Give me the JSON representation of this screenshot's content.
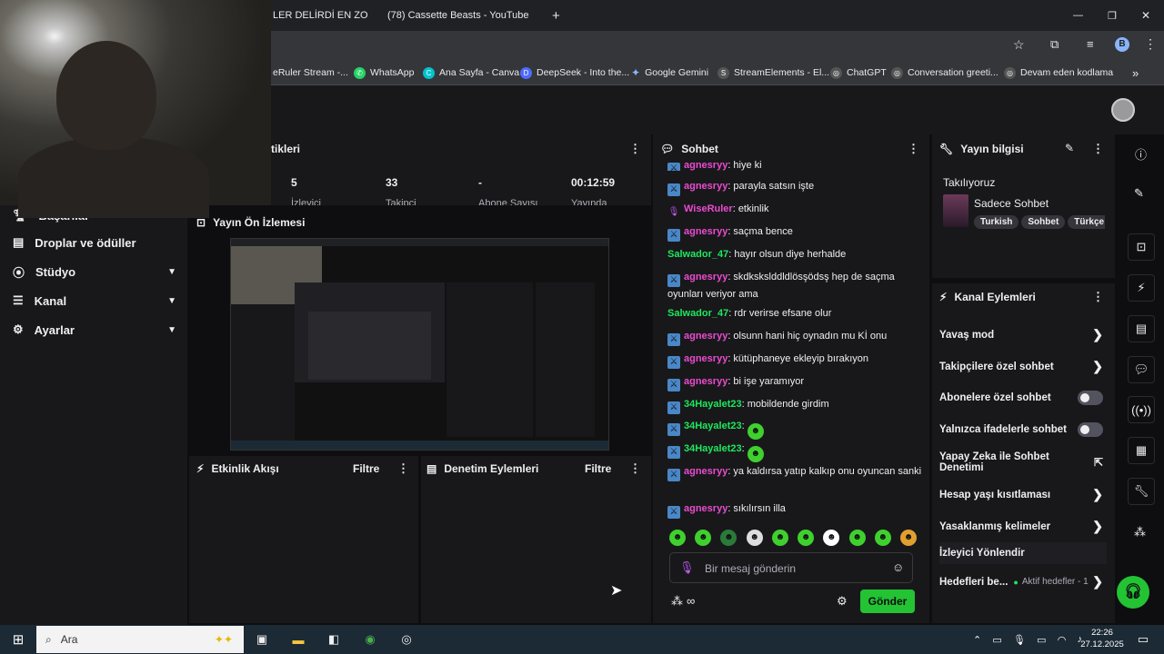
{
  "browser": {
    "tabs": [
      {
        "title": "LER DELİRDİ EN ZOR"
      },
      {
        "title": "(78) Cassette Beasts - YouTube"
      }
    ],
    "new_tab": "+",
    "window": {
      "minimize": "—",
      "maximize": "❐",
      "close": "✕"
    },
    "bookmarks": [
      {
        "label": "eRuler Stream -..."
      },
      {
        "label": "WhatsApp"
      },
      {
        "label": "Ana Sayfa - Canva"
      },
      {
        "label": "DeepSeek - Into the..."
      },
      {
        "label": "Google Gemini"
      },
      {
        "label": "StreamElements - El..."
      },
      {
        "label": "ChatGPT"
      },
      {
        "label": "Conversation greeti..."
      },
      {
        "label": "Devam eden kodlama"
      }
    ]
  },
  "nav": {
    "items": [
      {
        "label": "Başarılar"
      },
      {
        "label": "Droplar ve ödüller"
      },
      {
        "label": "Stüdyo"
      },
      {
        "label": "Kanal"
      },
      {
        "label": "Ayarlar"
      }
    ]
  },
  "stats": {
    "title": "tikleri",
    "items": [
      {
        "value": "5",
        "label": "İzleyici"
      },
      {
        "value": "33",
        "label": "Takipçi"
      },
      {
        "value": "-",
        "label": "Abone Sayısı"
      },
      {
        "value": "00:12:59",
        "label": "Yayında"
      }
    ]
  },
  "preview": {
    "title": "Yayın Ön İzlemesi"
  },
  "activity": {
    "title": "Etkinlik Akışı",
    "filter": "Filtre"
  },
  "moderation": {
    "title": "Denetim Eylemleri",
    "filter": "Filtre"
  },
  "chat": {
    "title": "Sohbet",
    "messages": [
      {
        "user": "agnesryy",
        "text": ": hiye ki"
      },
      {
        "user": "agnesryy",
        "text": ": parayla satsın işte"
      },
      {
        "user": "WiseRuler",
        "text": ": etkinlik"
      },
      {
        "user": "agnesryy",
        "text": ": saçma bence"
      },
      {
        "user": "Salwador_47",
        "text": ": hayır olsun diye herhalde"
      },
      {
        "user": "agnesryy",
        "text": ": skdkskslddldlösşödsş hep de saçma oyunları veriyor ama"
      },
      {
        "user": "Salwador_47",
        "text": ": rdr verirse efsane olur"
      },
      {
        "user": "agnesryy",
        "text": ": olsunn hani hiç oynadın mu Kİ onu"
      },
      {
        "user": "agnesryy",
        "text": ": kütüphaneye ekleyip bırakıyon"
      },
      {
        "user": "agnesryy",
        "text": ": bi işe yaramıyor"
      },
      {
        "user": "34Hayalet23",
        "text": ": mobildende girdim"
      },
      {
        "user": "34Hayalet23",
        "text": ":"
      },
      {
        "user": "34Hayalet23",
        "text": ":"
      },
      {
        "user": "agnesryy",
        "text": ": ya kaldırsa yatıp kalkıp onu oyuncan sanki"
      },
      {
        "user": "agnesryy",
        "text": ": sıkılırsın illa"
      }
    ],
    "input_placeholder": "Bir mesaj gönderin",
    "send_label": "Gönder",
    "points_label": "∞"
  },
  "info": {
    "title": "Yayın bilgisi",
    "status": "Takılıyoruz",
    "category": "Sadece Sohbet",
    "tags": [
      "Turkish",
      "Sohbet",
      "Türkçe"
    ]
  },
  "channel_actions": {
    "title": "Kanal Eylemleri",
    "items": [
      {
        "label": "Yavaş mod"
      },
      {
        "label": "Takipçilere özel sohbet"
      },
      {
        "label": "Abonelere özel sohbet"
      },
      {
        "label": "Yalnızca ifadelerle sohbet"
      },
      {
        "label": "Yapay Zeka ile Sohbet Denetimi"
      },
      {
        "label": "Hesap yaşı kısıtlaması"
      },
      {
        "label": "Yasaklanmış kelimeler"
      },
      {
        "label": "İzleyici Yönlendir"
      },
      {
        "label": "Hedefleri be..."
      }
    ],
    "goals_status": "Aktif hedefler - 1"
  },
  "taskbar": {
    "search_label": "Ara",
    "time": "22:26",
    "date": "27.12.2025"
  },
  "colors": {
    "accent_green": "#23c334",
    "username_pink": "#ea4bcf",
    "username_green": "#1ee85c"
  }
}
